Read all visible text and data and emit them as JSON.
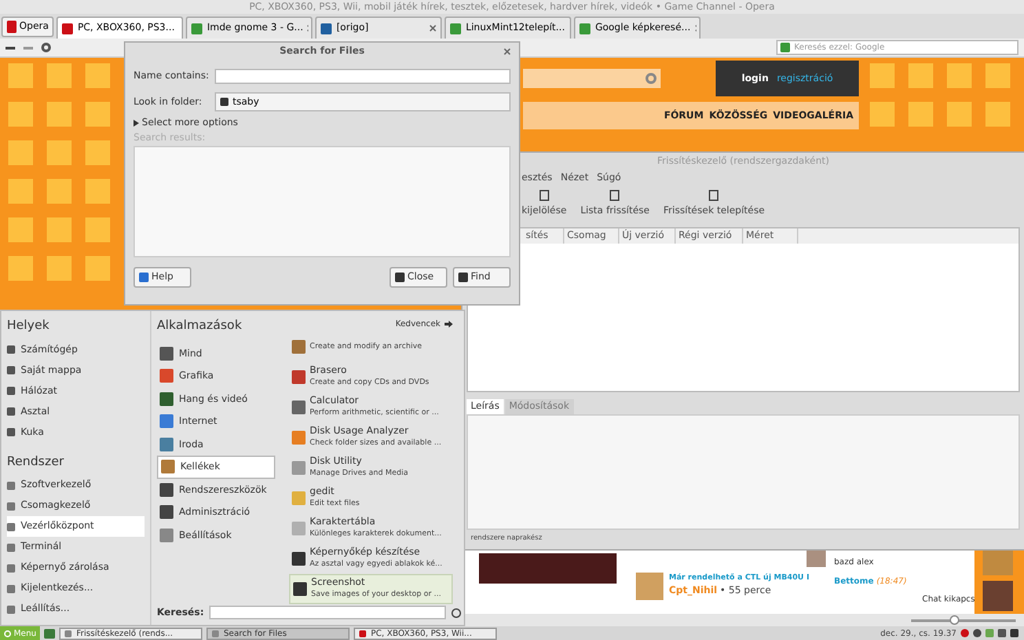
{
  "browser": {
    "title": "PC, XBOX360, PS3, Wii, mobil játék hírek, tesztek, előzetesek, hardver hírek, videók • Game Channel - Opera",
    "opera_button": "Opera",
    "tabs": [
      {
        "label": "PC, XBOX360, PS3...",
        "selected": true
      },
      {
        "label": "Imde gnome 3 - G...",
        "selected": false
      },
      {
        "label": "[origo]",
        "selected": false
      },
      {
        "label": "LinuxMint12telepít...",
        "selected": false
      },
      {
        "label": "Google képkeresé...",
        "selected": false
      }
    ],
    "search_placeholder": "Keresés ezzel: Google",
    "zoom": {
      "level": 0.4
    },
    "site": {
      "login": "login",
      "register": "regisztráció",
      "nav": [
        "FÓRUM",
        "KÖZÖSSÉG",
        "VIDEOGALÉRIA"
      ],
      "post": {
        "title": "Már rendelhető a CTL új MB40U I",
        "author": "Cpt_Nihil",
        "time": "• 55 perce"
      },
      "chat": {
        "message": "bazd alex",
        "name": "Bettome",
        "time": "(18:47)",
        "toggle": "Chat kikapcs"
      }
    }
  },
  "update_manager": {
    "title": "Frissítéskezelő (rendszergazdaként)",
    "menu": [
      "esztés",
      "Nézet",
      "Súgó"
    ],
    "toolbar": [
      "kijelölése",
      "Lista frissítése",
      "Frissítések telepítése"
    ],
    "columns": [
      "sítés",
      "Csomag",
      "Új verzió",
      "Régi verzió",
      "Méret"
    ],
    "tabs": [
      {
        "label": "Leírás",
        "selected": true
      },
      {
        "label": "Módosítások",
        "selected": false
      }
    ],
    "status": "rendszere naprakész"
  },
  "search_dialog": {
    "title": "Search for Files",
    "name_label": "Name contains:",
    "folder_label": "Look in folder:",
    "folder": "tsaby",
    "more_options": "Select more options",
    "results_label": "Search results:",
    "buttons": [
      "Help",
      "Close",
      "Find"
    ]
  },
  "menu": {
    "places_title": "Helyek",
    "places": [
      "Számítógép",
      "Saját mappa",
      "Hálózat",
      "Asztal",
      "Kuka"
    ],
    "system_title": "Rendszer",
    "system": [
      {
        "label": "Szoftverkezelő",
        "selected": false
      },
      {
        "label": "Csomagkezelő",
        "selected": false
      },
      {
        "label": "Vezérlőközpont",
        "selected": true
      },
      {
        "label": "Terminál",
        "selected": false
      },
      {
        "label": "Képernyő zárolása",
        "selected": false
      },
      {
        "label": "Kijelentkezés...",
        "selected": false
      },
      {
        "label": "Leállítás...",
        "selected": false
      }
    ],
    "apps_title": "Alkalmazások",
    "favorites": "Kedvencek",
    "categories": [
      {
        "label": "Mind",
        "selected": false,
        "color": "#555555"
      },
      {
        "label": "Grafika",
        "selected": false,
        "color": "#d9482b"
      },
      {
        "label": "Hang és videó",
        "selected": false,
        "color": "#2f5f2f"
      },
      {
        "label": "Internet",
        "selected": false,
        "color": "#3a7bd5"
      },
      {
        "label": "Iroda",
        "selected": false,
        "color": "#4a7fa0"
      },
      {
        "label": "Kellékek",
        "selected": true,
        "color": "#b07a3a"
      },
      {
        "label": "Rendszereszközök",
        "selected": false,
        "color": "#444444"
      },
      {
        "label": "Adminisztráció",
        "selected": false,
        "color": "#444444"
      },
      {
        "label": "Beállítások",
        "selected": false,
        "color": "#888888"
      }
    ],
    "apps": [
      {
        "description": "Create and modify an archive",
        "selected": false,
        "color": "#a0703a"
      },
      {
        "name": "Brasero",
        "description": "Create and copy CDs and DVDs",
        "selected": false,
        "color": "#c0392b"
      },
      {
        "name": "Calculator",
        "description": "Perform arithmetic, scientific or ...",
        "selected": false,
        "color": "#666666"
      },
      {
        "name": "Disk Usage Analyzer",
        "description": "Check folder sizes and available ...",
        "selected": false,
        "color": "#e67e22"
      },
      {
        "name": "Disk Utility",
        "description": "Manage Drives and Media",
        "selected": false,
        "color": "#999999"
      },
      {
        "name": "gedit",
        "description": "Edit text files",
        "selected": false,
        "color": "#e0b040"
      },
      {
        "name": "Karaktertábla",
        "description": "Különleges karakterek dokument...",
        "selected": false,
        "color": "#b0b0b0"
      },
      {
        "name": "Képernyőkép készítése",
        "description": "Az asztal vagy egyedi ablakok ké...",
        "selected": false,
        "color": "#333333"
      },
      {
        "name": "Screenshot",
        "description": "Save images of your desktop or ...",
        "selected": true,
        "color": "#333333"
      }
    ],
    "search_label": "Keresés:"
  },
  "taskbar": {
    "menu": "Menu",
    "tasks": [
      {
        "label": "Frissítéskezelő (rends...",
        "selected": false
      },
      {
        "label": "Search for Files",
        "selected": true
      },
      {
        "label": "PC, XBOX360, PS3, Wii...",
        "selected": false
      }
    ],
    "clock": "dec. 29., cs. 19.37"
  }
}
